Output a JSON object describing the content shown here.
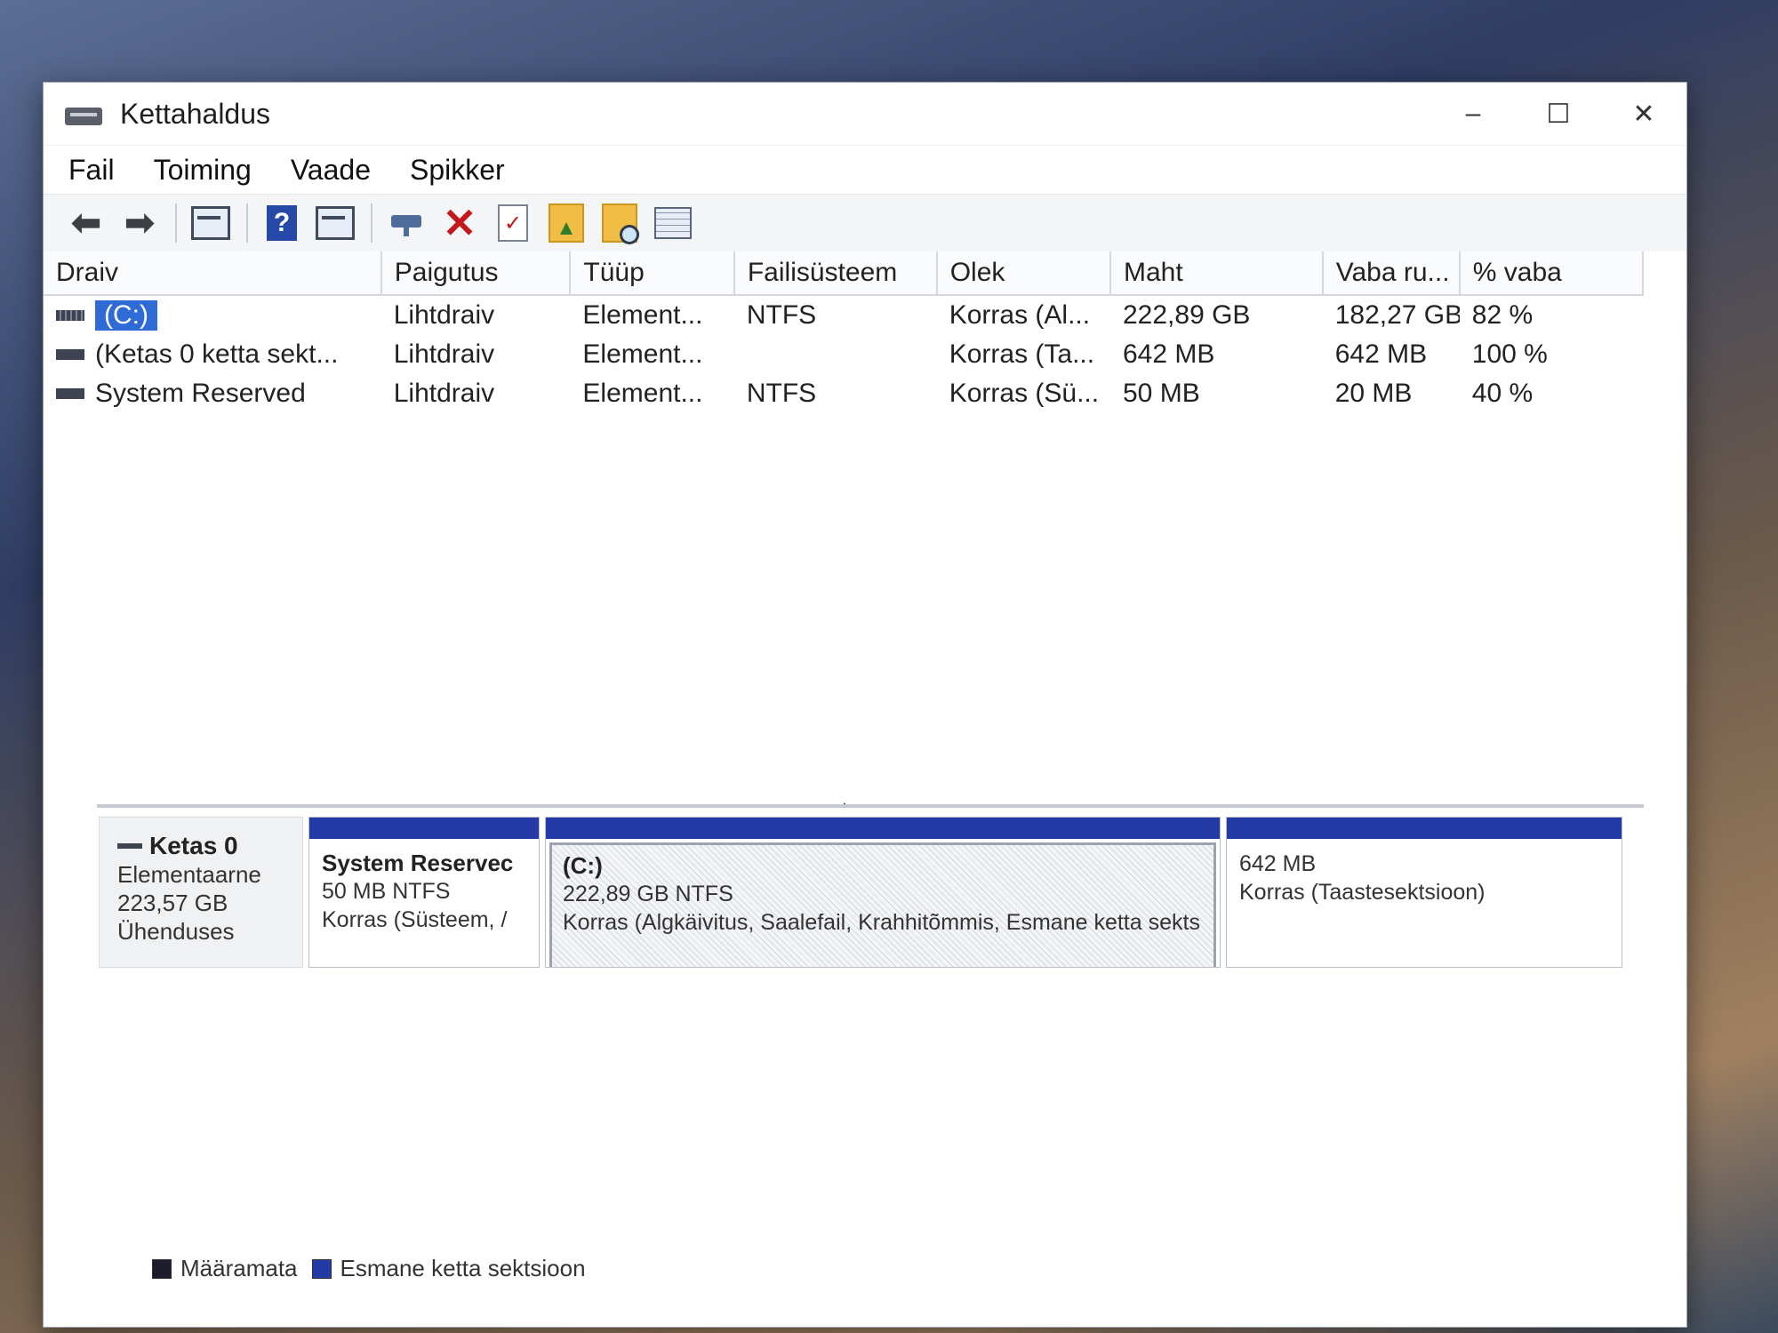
{
  "window": {
    "title": "Kettahaldus",
    "minimize": "–",
    "maximize": "☐",
    "close": "✕"
  },
  "menu": [
    "Fail",
    "Toiming",
    "Vaade",
    "Spikker"
  ],
  "toolbar": {
    "icons": [
      "back-arrow-icon",
      "forward-arrow-icon",
      "console-tree-icon",
      "help-icon",
      "action-pane-icon",
      "connect-drive-icon",
      "delete-icon",
      "properties-icon",
      "open-folder-icon",
      "explore-icon",
      "settings-grid-icon"
    ]
  },
  "volumes": {
    "headers": [
      "Draiv",
      "Paigutus",
      "Tüüp",
      "Failisüsteem",
      "Olek",
      "Maht",
      "Vaba ru...",
      "% vaba"
    ],
    "rows": [
      [
        "(C:)",
        "Lihtdraiv",
        "Element...",
        "NTFS",
        "Korras (Al...",
        "222,89 GB",
        "182,27 GB",
        "82 %"
      ],
      [
        "(Ketas 0 ketta sekt...",
        "Lihtdraiv",
        "Element...",
        "",
        "Korras (Ta...",
        "642 MB",
        "642 MB",
        "100 %"
      ],
      [
        "System Reserved",
        "Lihtdraiv",
        "Element...",
        "NTFS",
        "Korras (Sü...",
        "50 MB",
        "20 MB",
        "40 %"
      ]
    ]
  },
  "disk0": {
    "name": "Ketas 0",
    "type": "Elementaarne",
    "size": "223,57 GB",
    "status": "Ühenduses",
    "partitions": [
      {
        "title": "System Reservec",
        "line1": "50 MB NTFS",
        "line2": "Korras (Süsteem, /"
      },
      {
        "title": "(C:)",
        "line1": "222,89 GB NTFS",
        "line2": "Korras (Algkäivitus, Saalefail, Krahhitõmmis, Esmane ketta sekts"
      },
      {
        "title": "",
        "line1": "642 MB",
        "line2": "Korras (Taastesektsioon)"
      }
    ]
  },
  "legend": [
    {
      "label": "Määramata",
      "color": "#1c1c2a"
    },
    {
      "label": "Esmane ketta sektsioon",
      "color": "#243aa6"
    }
  ]
}
